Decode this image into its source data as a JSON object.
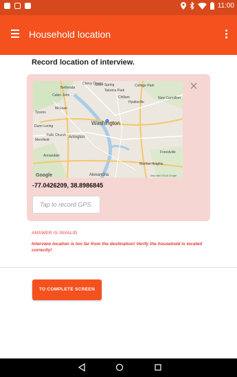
{
  "status_bar": {
    "time": "11:00",
    "icons": [
      "location-icon",
      "bluetooth-icon",
      "wifi-icon",
      "battery-icon"
    ],
    "color": "#d7481c"
  },
  "app_bar": {
    "title": "Household location",
    "color": "#f4511e"
  },
  "question": {
    "label": "Record location of interview."
  },
  "map": {
    "places": [
      "Bethesda",
      "Silver Spring",
      "Takoma Park",
      "College Park",
      "Cabin John",
      "Chillum",
      "Hyattsville",
      "New Carrollton",
      "Tysons",
      "McLean",
      "Washington",
      "Dunn Loring",
      "Falls Church",
      "Arlington",
      "Merrifield",
      "Annandale",
      "Alexandria",
      "Marlow Heights",
      "Forestville",
      "Chevy Chase"
    ],
    "attribution": "Map data ©2018 Google",
    "logo": "Google"
  },
  "location": {
    "coordinates": "-77.0426209, 38.8986845",
    "record_button": "Tap to record GPS"
  },
  "validation": {
    "title": "ANSWER IS INVALID",
    "message": "Interview location is too far from the destination! Verify the household is located correctly!",
    "color": "#e53935"
  },
  "actions": {
    "complete_label": "TO COMPLETE SCREEN"
  },
  "nav": {
    "items": [
      "back-icon",
      "home-icon",
      "recents-icon"
    ]
  }
}
